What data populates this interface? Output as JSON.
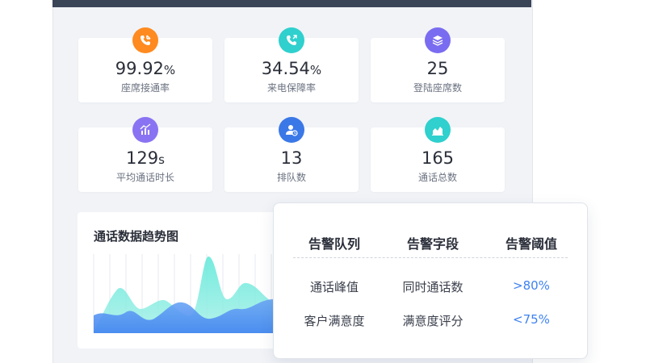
{
  "stats": [
    {
      "value": "99.92",
      "unit": "%",
      "label": "座席接通率",
      "icon": "phone-incoming-icon",
      "color": "#ff8a1f"
    },
    {
      "value": "34.54",
      "unit": "%",
      "label": "来电保障率",
      "icon": "phone-outgoing-icon",
      "color": "#2fd0cd"
    },
    {
      "value": "25",
      "unit": "",
      "label": "登陆座席数",
      "icon": "layers-icon",
      "color": "#7a6cf0"
    },
    {
      "value": "129",
      "unit": "s",
      "label": "平均通话时长",
      "icon": "bar-chart-icon",
      "color": "#8a73f2"
    },
    {
      "value": "13",
      "unit": "",
      "label": "排队数",
      "icon": "user-clock-icon",
      "color": "#3b78e7"
    },
    {
      "value": "165",
      "unit": "",
      "label": "通话总数",
      "icon": "area-chart-icon",
      "color": "#2fd0cd"
    }
  ],
  "trend": {
    "title": "通话数据趋势图"
  },
  "alert_table": {
    "headers": [
      "告警队列",
      "告警字段",
      "告警阈值"
    ],
    "rows": [
      [
        "通话峰值",
        "同时通话数",
        ">80%"
      ],
      [
        "客户满意度",
        "满意度评分",
        "<75%"
      ]
    ]
  },
  "colors": {
    "topbar": "#3a4558",
    "threshold_text": "#3f82f0",
    "chart_teal": "#5de8d8",
    "chart_blue": "#3f82f0"
  }
}
